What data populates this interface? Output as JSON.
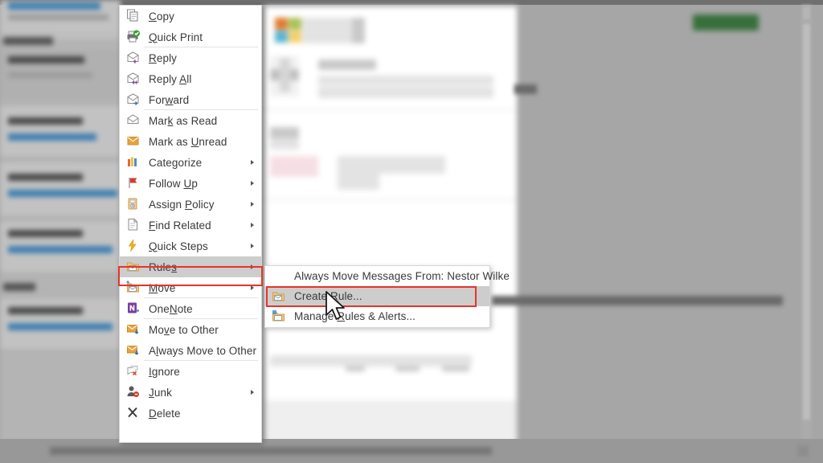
{
  "app": {
    "name": "Outlook message context menu",
    "background_color": "#a6a6a6"
  },
  "context_menu": {
    "name": "message-context-menu",
    "items": [
      {
        "label": "Copy",
        "icon": "copy-icon",
        "submenu": false,
        "separator_after": false,
        "highlighted": false
      },
      {
        "label": "Quick Print",
        "icon": "quick-print-icon",
        "submenu": false,
        "separator_after": true,
        "highlighted": false
      },
      {
        "label": "Reply",
        "icon": "reply-icon",
        "submenu": false,
        "separator_after": false,
        "highlighted": false
      },
      {
        "label": "Reply All",
        "icon": "reply-all-icon",
        "submenu": false,
        "separator_after": false,
        "highlighted": false
      },
      {
        "label": "Forward",
        "icon": "forward-icon",
        "submenu": false,
        "separator_after": true,
        "highlighted": false
      },
      {
        "label": "Mark as Read",
        "icon": "mark-as-read-icon",
        "submenu": false,
        "separator_after": false,
        "highlighted": false
      },
      {
        "label": "Mark as Unread",
        "icon": "mark-as-unread-icon",
        "submenu": false,
        "separator_after": false,
        "highlighted": false
      },
      {
        "label": "Categorize",
        "icon": "categorize-icon",
        "submenu": true,
        "separator_after": false,
        "highlighted": false
      },
      {
        "label": "Follow Up",
        "icon": "follow-up-flag-icon",
        "submenu": true,
        "separator_after": false,
        "highlighted": false
      },
      {
        "label": "Assign Policy",
        "icon": "assign-policy-icon",
        "submenu": true,
        "separator_after": false,
        "highlighted": false
      },
      {
        "label": "Find Related",
        "icon": "find-related-icon",
        "submenu": true,
        "separator_after": false,
        "highlighted": false
      },
      {
        "label": "Quick Steps",
        "icon": "quick-steps-lightning-icon",
        "submenu": true,
        "separator_after": false,
        "highlighted": false
      },
      {
        "label": "Rules",
        "icon": "rules-folder-icon",
        "submenu": true,
        "separator_after": false,
        "highlighted": true
      },
      {
        "label": "Move",
        "icon": "move-folder-icon",
        "submenu": true,
        "separator_after": true,
        "highlighted": false
      },
      {
        "label": "OneNote",
        "icon": "onenote-icon",
        "submenu": false,
        "separator_after": true,
        "highlighted": false
      },
      {
        "label": "Move to Other",
        "icon": "move-to-other-icon",
        "submenu": false,
        "separator_after": false,
        "highlighted": false
      },
      {
        "label": "Always Move to Other",
        "icon": "always-move-to-other-icon",
        "submenu": false,
        "separator_after": true,
        "highlighted": false
      },
      {
        "label": "Ignore",
        "icon": "ignore-icon",
        "submenu": false,
        "separator_after": false,
        "highlighted": false
      },
      {
        "label": "Junk",
        "icon": "junk-person-icon",
        "submenu": true,
        "separator_after": false,
        "highlighted": false
      },
      {
        "label": "Delete",
        "icon": "delete-x-icon",
        "submenu": false,
        "separator_after": false,
        "highlighted": false
      }
    ]
  },
  "rules_submenu": {
    "name": "rules-submenu",
    "items": [
      {
        "label": "Always Move Messages From: Nestor Wilke",
        "icon": "",
        "highlighted": false
      },
      {
        "label": "Create Rule...",
        "icon": "create-rule-icon",
        "highlighted": true
      },
      {
        "label": "Manage Rules & Alerts...",
        "icon": "manage-rules-icon",
        "highlighted": false
      }
    ]
  },
  "annotations": {
    "highlight_color": "#e8332a",
    "boxes": [
      {
        "name": "rules-menu-item-highlight-box"
      },
      {
        "name": "create-rule-menu-item-highlight-box"
      }
    ]
  },
  "cursor": {
    "name": "mouse-pointer",
    "type": "arrow"
  }
}
